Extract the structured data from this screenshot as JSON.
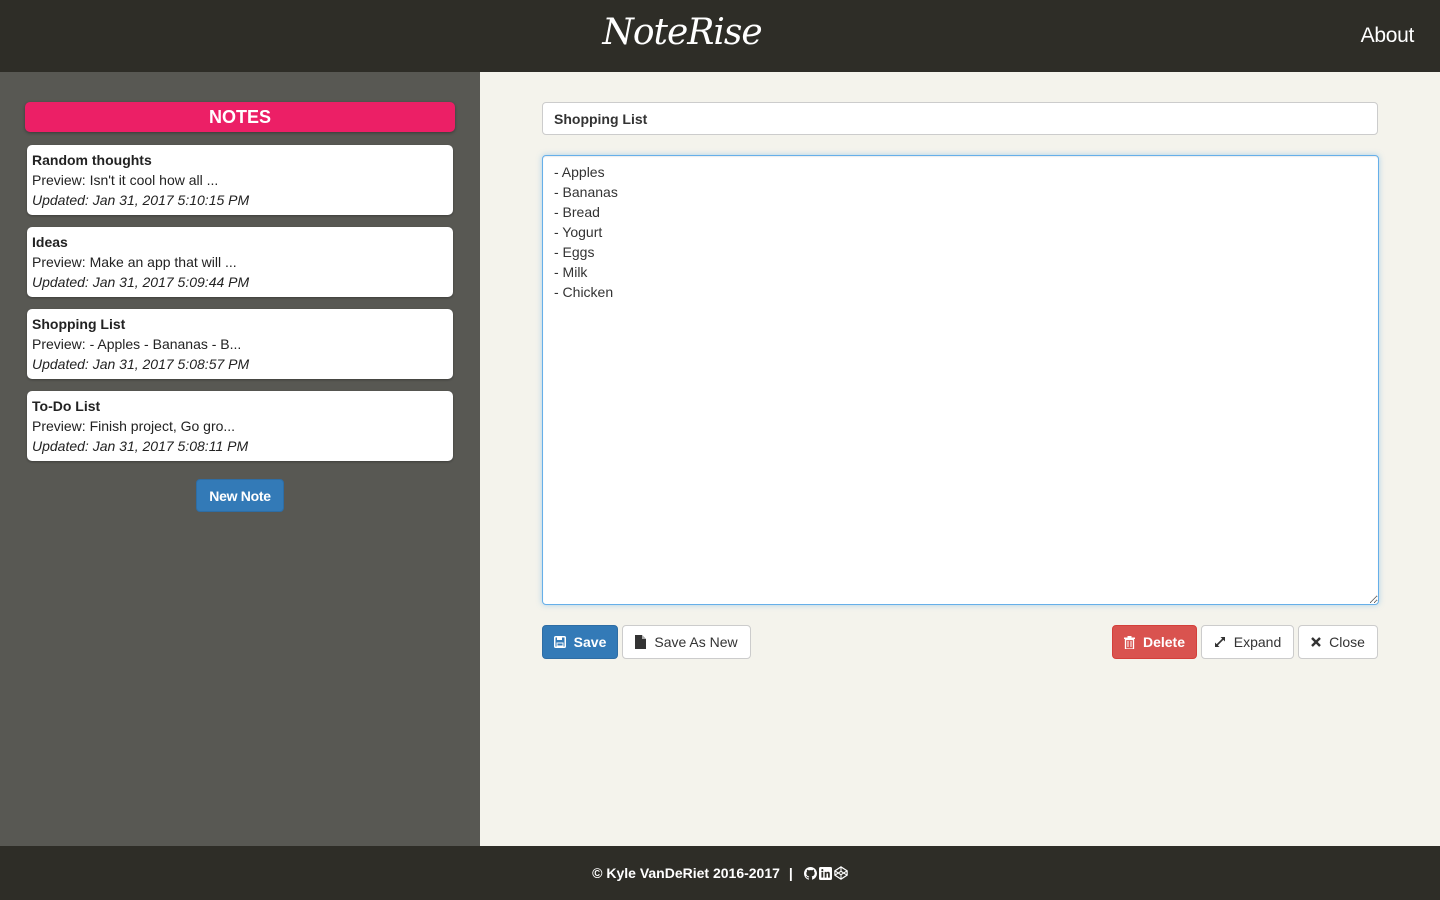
{
  "header": {
    "brand": "NoteRise",
    "about_label": "About"
  },
  "sidebar": {
    "heading": "NOTES",
    "notes": [
      {
        "title": "Random thoughts",
        "preview": "Preview: Isn't it cool how all ...",
        "updated": "Updated: Jan 31, 2017 5:10:15 PM"
      },
      {
        "title": "Ideas",
        "preview": "Preview: Make an app that will ...",
        "updated": "Updated: Jan 31, 2017 5:09:44 PM"
      },
      {
        "title": "Shopping List",
        "preview": "Preview: - Apples - Bananas - B...",
        "updated": "Updated: Jan 31, 2017 5:08:57 PM"
      },
      {
        "title": "To-Do List",
        "preview": "Preview: Finish project, Go gro...",
        "updated": "Updated: Jan 31, 2017 5:08:11 PM"
      }
    ],
    "new_note_label": "New Note"
  },
  "editor": {
    "title_value": "Shopping List",
    "body_value": "- Apples\n- Bananas\n- Bread\n- Yogurt\n- Eggs\n- Milk\n- Chicken",
    "save_label": "Save",
    "save_as_new_label": "Save As New",
    "delete_label": "Delete",
    "expand_label": "Expand",
    "close_label": "Close"
  },
  "footer": {
    "copyright": "© Kyle VanDeRiet 2016-2017",
    "separator": "|",
    "icons": [
      "github-icon",
      "linkedin-icon",
      "codepen-icon"
    ]
  },
  "colors": {
    "topbar": "#2e2d27",
    "sidebar": "#585853",
    "notes_heading": "#ec1f66",
    "primary": "#337ab7",
    "danger": "#d9534f",
    "main_bg": "#f4f3ec"
  }
}
